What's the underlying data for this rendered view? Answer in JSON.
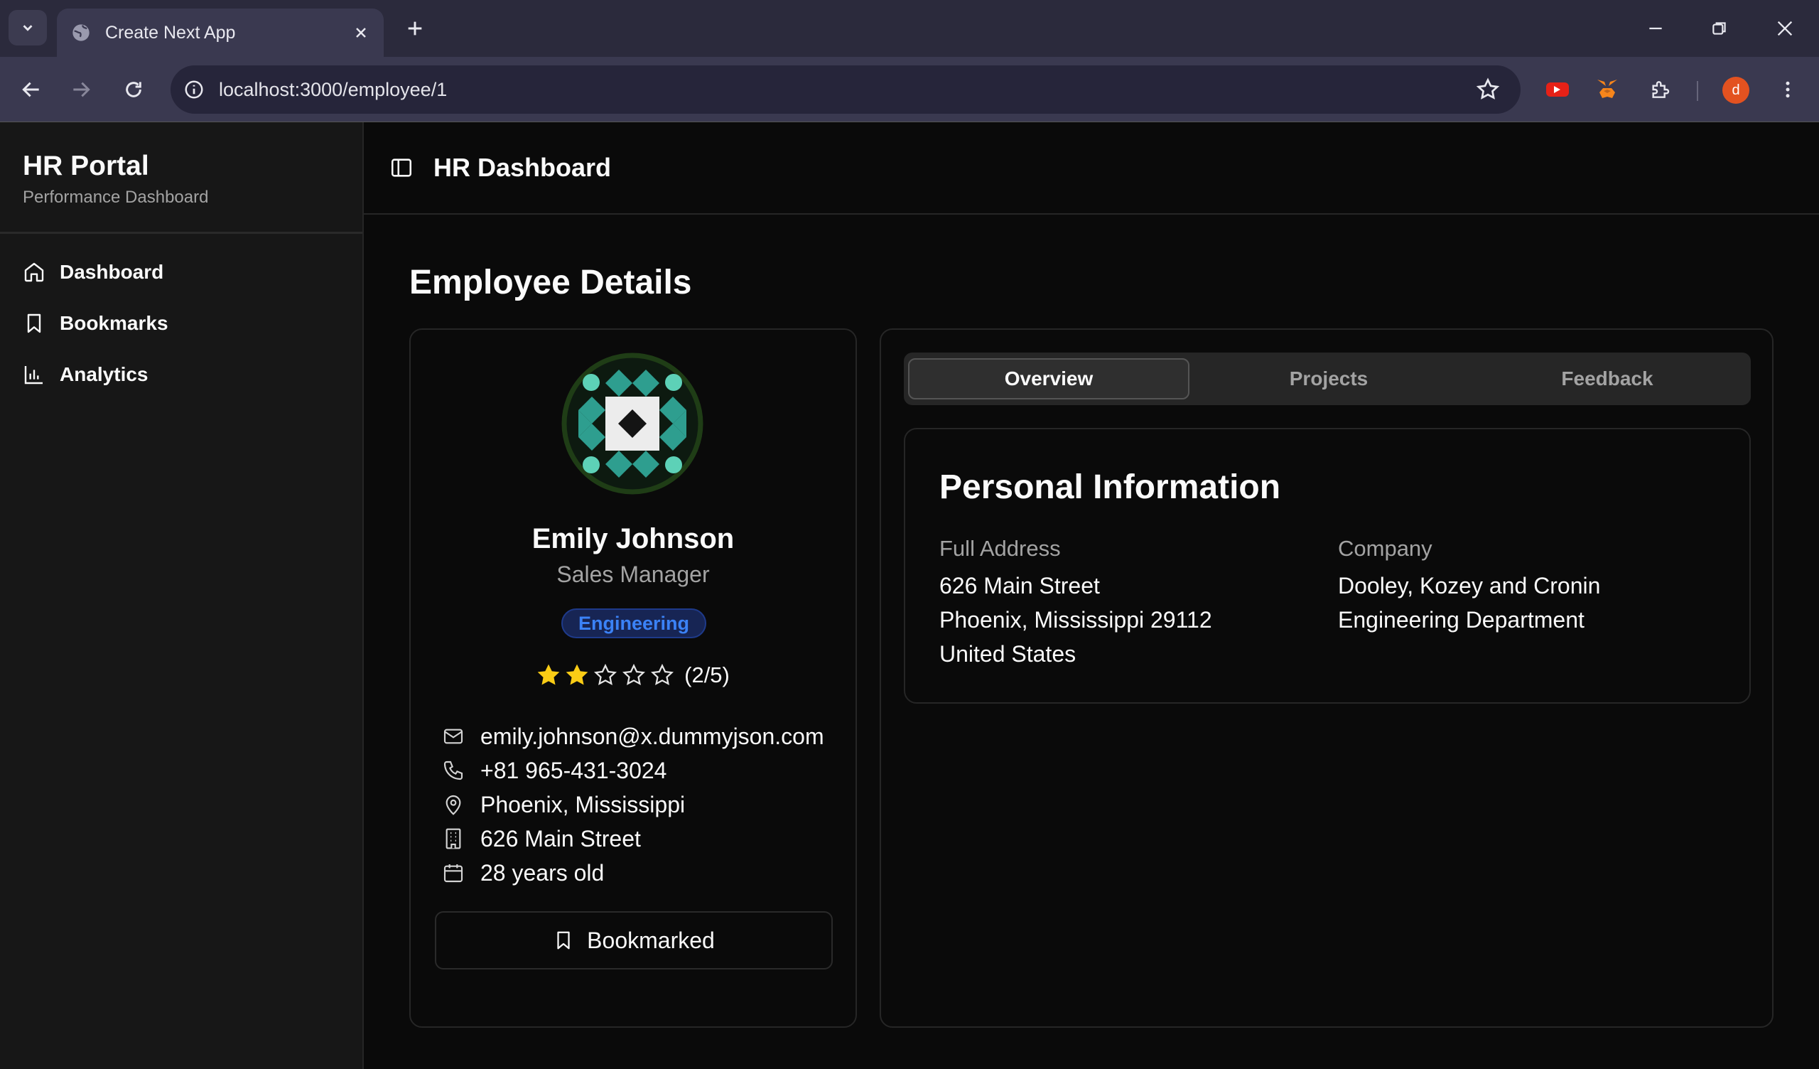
{
  "browser": {
    "tab_title": "Create Next App",
    "url": "localhost:3000/employee/1",
    "profile_initial": "d"
  },
  "sidebar": {
    "title": "HR Portal",
    "subtitle": "Performance Dashboard",
    "items": [
      {
        "label": "Dashboard",
        "icon": "home-icon"
      },
      {
        "label": "Bookmarks",
        "icon": "bookmark-icon"
      },
      {
        "label": "Analytics",
        "icon": "bar-chart-icon"
      }
    ]
  },
  "header": {
    "title": "HR Dashboard"
  },
  "page": {
    "title": "Employee Details"
  },
  "employee": {
    "name": "Emily Johnson",
    "role": "Sales Manager",
    "department_badge": "Engineering",
    "rating": 2,
    "rating_max": 5,
    "rating_text": "(2/5)",
    "email": "emily.johnson@x.dummyjson.com",
    "phone": "+81 965-431-3024",
    "location": "Phoenix, Mississippi",
    "street": "626 Main Street",
    "age": "28 years old",
    "bookmark_label": "Bookmarked"
  },
  "tabs": [
    {
      "label": "Overview",
      "active": true
    },
    {
      "label": "Projects",
      "active": false
    },
    {
      "label": "Feedback",
      "active": false
    }
  ],
  "personal_info": {
    "title": "Personal Information",
    "address_label": "Full Address",
    "address_lines": [
      "626 Main Street",
      "Phoenix, Mississippi 29112",
      "United States"
    ],
    "company_label": "Company",
    "company_lines": [
      "Dooley, Kozey and Cronin",
      "Engineering Department"
    ]
  },
  "colors": {
    "background": "#0a0a0a",
    "sidebar": "#171717",
    "badge_text": "#3b82f6",
    "star_filled": "#facc15"
  }
}
